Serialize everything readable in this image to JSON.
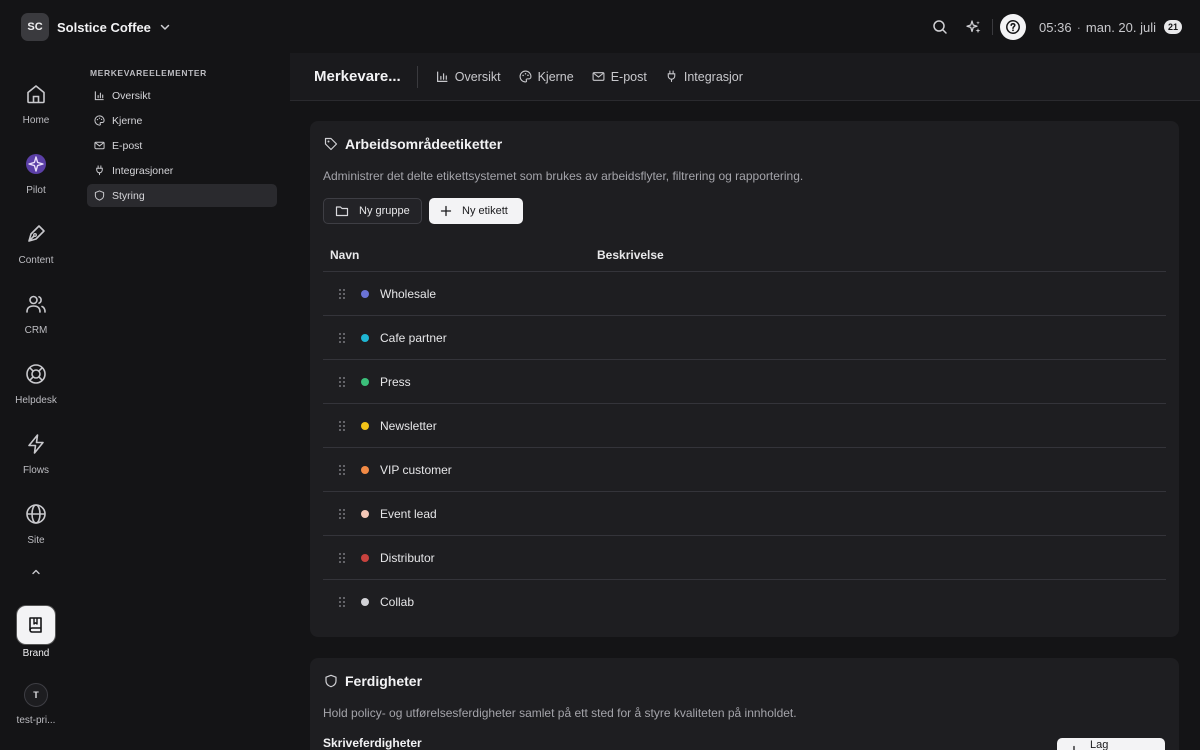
{
  "workspace": {
    "initials": "SC",
    "name": "Solstice Coffee"
  },
  "topbar": {
    "time": "05:36",
    "separator": "·",
    "date": "man. 20. juli",
    "day_badge": "21"
  },
  "rail": {
    "items": [
      {
        "label": "Home",
        "icon": "home-icon"
      },
      {
        "label": "Pilot",
        "icon": "pilot-icon"
      },
      {
        "label": "Content",
        "icon": "pen-icon"
      },
      {
        "label": "CRM",
        "icon": "users-icon"
      },
      {
        "label": "Helpdesk",
        "icon": "lifebuoy-icon"
      },
      {
        "label": "Flows",
        "icon": "bolt-icon"
      },
      {
        "label": "Site",
        "icon": "globe-icon"
      }
    ],
    "brand_label": "Brand",
    "user_initial": "T",
    "user_label": "test-pri..."
  },
  "subnav": {
    "title": "MERKEVAREELEMENTER",
    "items": [
      {
        "label": "Oversikt",
        "icon": "bar-chart-icon"
      },
      {
        "label": "Kjerne",
        "icon": "palette-icon"
      },
      {
        "label": "E-post",
        "icon": "mail-icon"
      },
      {
        "label": "Integrasjoner",
        "icon": "plug-icon"
      },
      {
        "label": "Styring",
        "icon": "shield-icon",
        "active": true
      }
    ]
  },
  "mainhead": {
    "title": "Merkevare...",
    "tabs": [
      {
        "label": "Oversikt"
      },
      {
        "label": "Kjerne"
      },
      {
        "label": "E-post"
      },
      {
        "label": "Integrasjor"
      }
    ]
  },
  "tags_card": {
    "title": "Arbeidsområdeetiketter",
    "description": "Administrer det delte etikettsystemet som brukes av arbeidsflyter, filtrering og rapportering.",
    "new_group": "Ny gruppe",
    "new_tag": "Ny etikett",
    "col_name": "Navn",
    "col_desc": "Beskrivelse",
    "rows": [
      {
        "name": "Wholesale",
        "color": "#6b73d6"
      },
      {
        "name": "Cafe partner",
        "color": "#1fb6d3"
      },
      {
        "name": "Press",
        "color": "#3bbf7a"
      },
      {
        "name": "Newsletter",
        "color": "#f2c318"
      },
      {
        "name": "VIP customer",
        "color": "#f28a45"
      },
      {
        "name": "Event lead",
        "color": "#f5c8b8"
      },
      {
        "name": "Distributor",
        "color": "#c8423e"
      },
      {
        "name": "Collab",
        "color": "#d2d2d6"
      }
    ]
  },
  "skills_card": {
    "title": "Ferdigheter",
    "description": "Hold policy- og utførelsesferdigheter samlet på ett sted for å styre kvaliteten på innholdet.",
    "subhead": "Skriveferdigheter",
    "add_button": "Lag ferdighet"
  }
}
